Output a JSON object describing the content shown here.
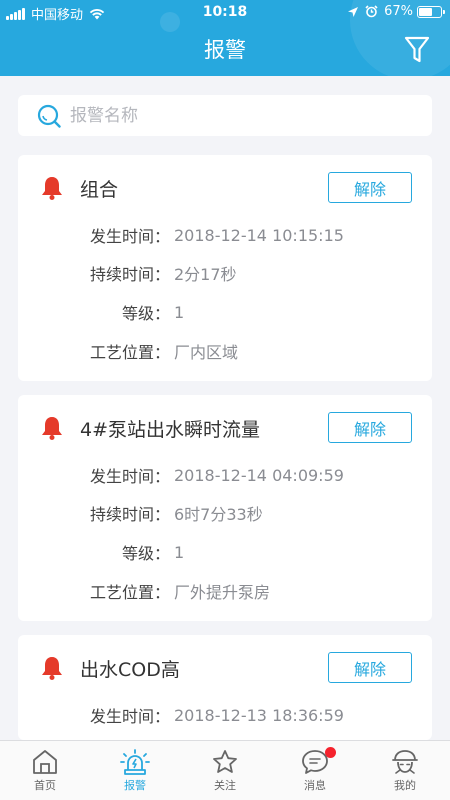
{
  "status_bar": {
    "carrier": "中国移动",
    "time": "10:18",
    "battery": "67%",
    "battery_level": 0.67
  },
  "nav": {
    "title": "报警",
    "filter_icon": "filter-funnel-icon"
  },
  "search": {
    "placeholder": "报警名称",
    "value": ""
  },
  "colors": {
    "primary": "#27a8de",
    "alarm": "#e53a2a",
    "badge": "#f5222d"
  },
  "alarms": [
    {
      "title": "组合",
      "button": "解除",
      "rows": [
        {
          "label": "发生时间：",
          "value": "2018-12-14 10:15:15"
        },
        {
          "label": "持续时间：",
          "value": "2分17秒"
        },
        {
          "label": "等级：",
          "value": "1"
        },
        {
          "label": "工艺位置：",
          "value": "厂内区域"
        }
      ]
    },
    {
      "title": "4#泵站出水瞬时流量",
      "button": "解除",
      "rows": [
        {
          "label": "发生时间：",
          "value": "2018-12-14 04:09:59"
        },
        {
          "label": "持续时间：",
          "value": "6时7分33秒"
        },
        {
          "label": "等级：",
          "value": "1"
        },
        {
          "label": "工艺位置：",
          "value": "厂外提升泵房"
        }
      ]
    },
    {
      "title": "出水COD高",
      "button": "解除",
      "rows": [
        {
          "label": "发生时间：",
          "value": "2018-12-13 18:36:59"
        }
      ]
    }
  ],
  "tabs": [
    {
      "label": "首页",
      "icon": "home-icon"
    },
    {
      "label": "报警",
      "icon": "alarm-siren-icon",
      "active": true
    },
    {
      "label": "关注",
      "icon": "star-icon"
    },
    {
      "label": "消息",
      "icon": "message-bubble-icon",
      "badge": true
    },
    {
      "label": "我的",
      "icon": "profile-icon"
    }
  ]
}
